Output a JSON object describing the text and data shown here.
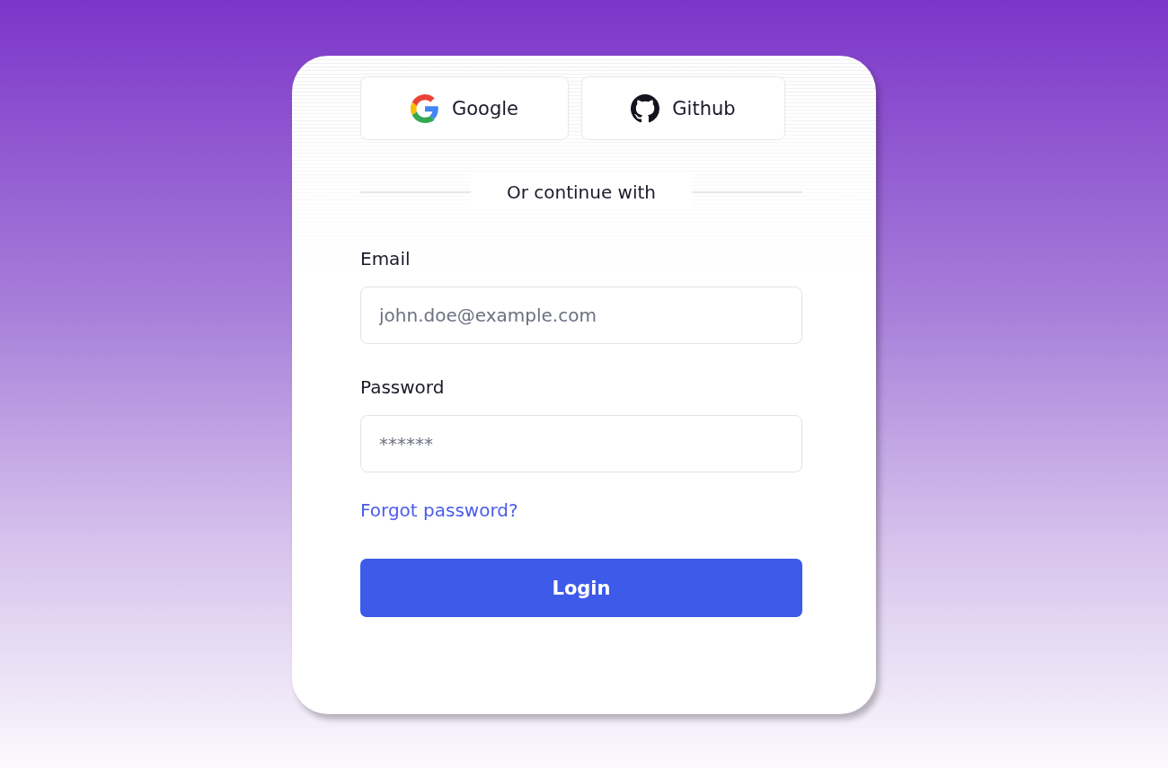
{
  "social_buttons": [
    {
      "kind": "google",
      "label": "Google"
    },
    {
      "kind": "github",
      "label": "Github"
    }
  ],
  "divider_text": "Or continue with",
  "fields": [
    {
      "label": "Email",
      "placeholder": "john.doe@example.com"
    },
    {
      "label": "Password",
      "placeholder": "******"
    }
  ],
  "forgot_link": "Forgot password?",
  "submit_button": "Login"
}
